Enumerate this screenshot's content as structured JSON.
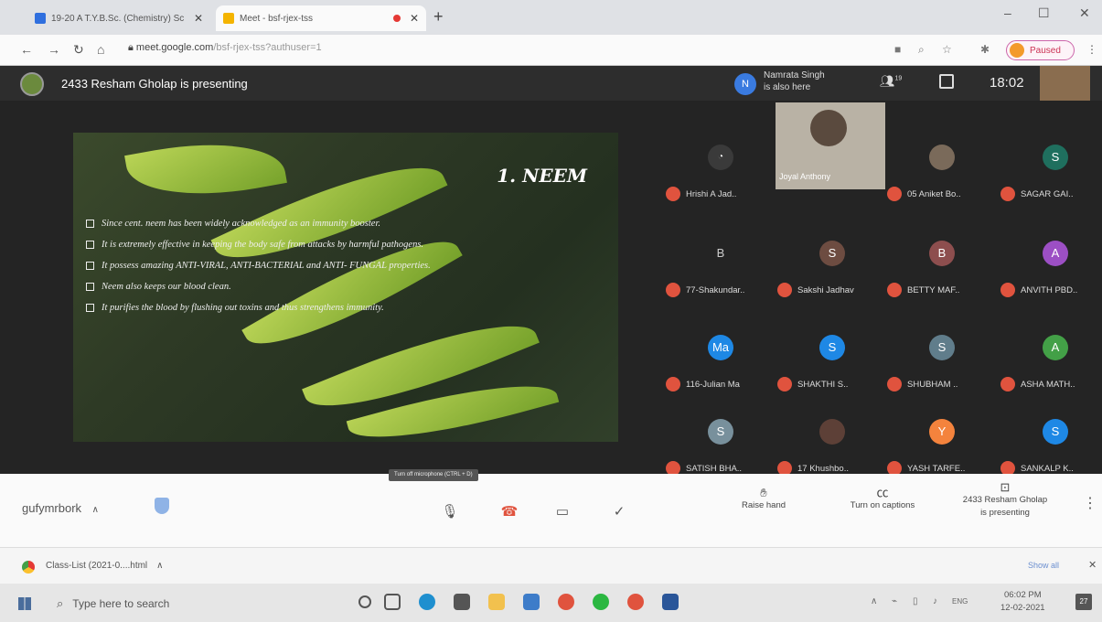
{
  "browser": {
    "tabs": [
      {
        "title": "19-20 A T.Y.B.Sc. (Chemistry) Sc"
      },
      {
        "title": "Meet - bsf-rjex-tss"
      }
    ],
    "new_tab": "+",
    "window_controls": [
      "–",
      "☐",
      "✕"
    ],
    "url_host": "meet.google.com",
    "url_path": "/bsf-rjex-tss?authuser=1",
    "profile_status": "Paused"
  },
  "meet": {
    "presenter_banner": "2433 Resham Gholap is presenting",
    "also_here": {
      "initial": "N",
      "name": "Namrata Singh",
      "subtitle": "is also here"
    },
    "participant_count": "19",
    "time": "18:02",
    "slide": {
      "title": "1. NEEM",
      "bullets": [
        "Since cent. neem has been widely acknowledged as an immunity booster.",
        "It is extremely effective in keeping the body safe from attacks by harmful pathogens.",
        "It possess amazing ANTI-VIRAL, ANTI-BACTERIAL and ANTI- FUNGAL properties.",
        "Neem also keeps our blood clean.",
        "It purifies the blood by flushing out toxins and thus strengthens immunity."
      ]
    },
    "participants": [
      {
        "name": "Hrishi A Jad..",
        "initial": "",
        "color": "#242424",
        "icon": "photo"
      },
      {
        "name": "Joyal Anthony",
        "camera": true
      },
      {
        "name": "05 Aniket Bo..",
        "initial": "",
        "color": "#7a6a5a",
        "icon": "photo"
      },
      {
        "name": "SAGAR GAI..",
        "initial": "S",
        "color": "#1f6f5e"
      },
      {
        "name": "77-Shakundar..",
        "initial": "B",
        "color": "#242424"
      },
      {
        "name": "Sakshi Jadhav",
        "initial": "S",
        "color": "#6d4c41"
      },
      {
        "name": "BETTY MAF..",
        "initial": "B",
        "color": "#8d4e4e"
      },
      {
        "name": "ANVITH PBD..",
        "initial": "A",
        "color": "#9c4fc4"
      },
      {
        "name": "116-Julian Ma",
        "initial": "Ma",
        "color": "#1e88e5"
      },
      {
        "name": "SHAKTHI S..",
        "initial": "S",
        "color": "#1e88e5"
      },
      {
        "name": "SHUBHAM ..",
        "initial": "S",
        "color": "#607d8b"
      },
      {
        "name": "ASHA MATH..",
        "initial": "A",
        "color": "#43a047"
      },
      {
        "name": "SATISH BHA..",
        "initial": "S",
        "color": "#78909c"
      },
      {
        "name": "17 Khushbo..",
        "initial": "",
        "color": "#5d4037",
        "icon": "photo"
      },
      {
        "name": "YASH TARFE..",
        "initial": "Y",
        "color": "#f4833d"
      },
      {
        "name": "SANKALP K..",
        "initial": "S",
        "color": "#1e88e5"
      }
    ],
    "controls": {
      "meeting_code": "gufymrbork",
      "tooltip": "Turn off microphone (CTRL + D)",
      "raise_hand": "Raise hand",
      "captions": "Turn on captions",
      "presenting_l1": "2433 Resham Gholap",
      "presenting_l2": "is presenting"
    }
  },
  "downloads": {
    "file": "Class-List (2021-0....html",
    "show_all": "Show all"
  },
  "taskbar": {
    "search_placeholder": "Type here to search",
    "lang": "ENG",
    "time": "06:02 PM",
    "date": "12-02-2021",
    "notifications": "27"
  },
  "colors": {
    "meet_dark": "#242424",
    "mic_off_red": "#e0533e",
    "accent_blue": "#1e88e5"
  }
}
